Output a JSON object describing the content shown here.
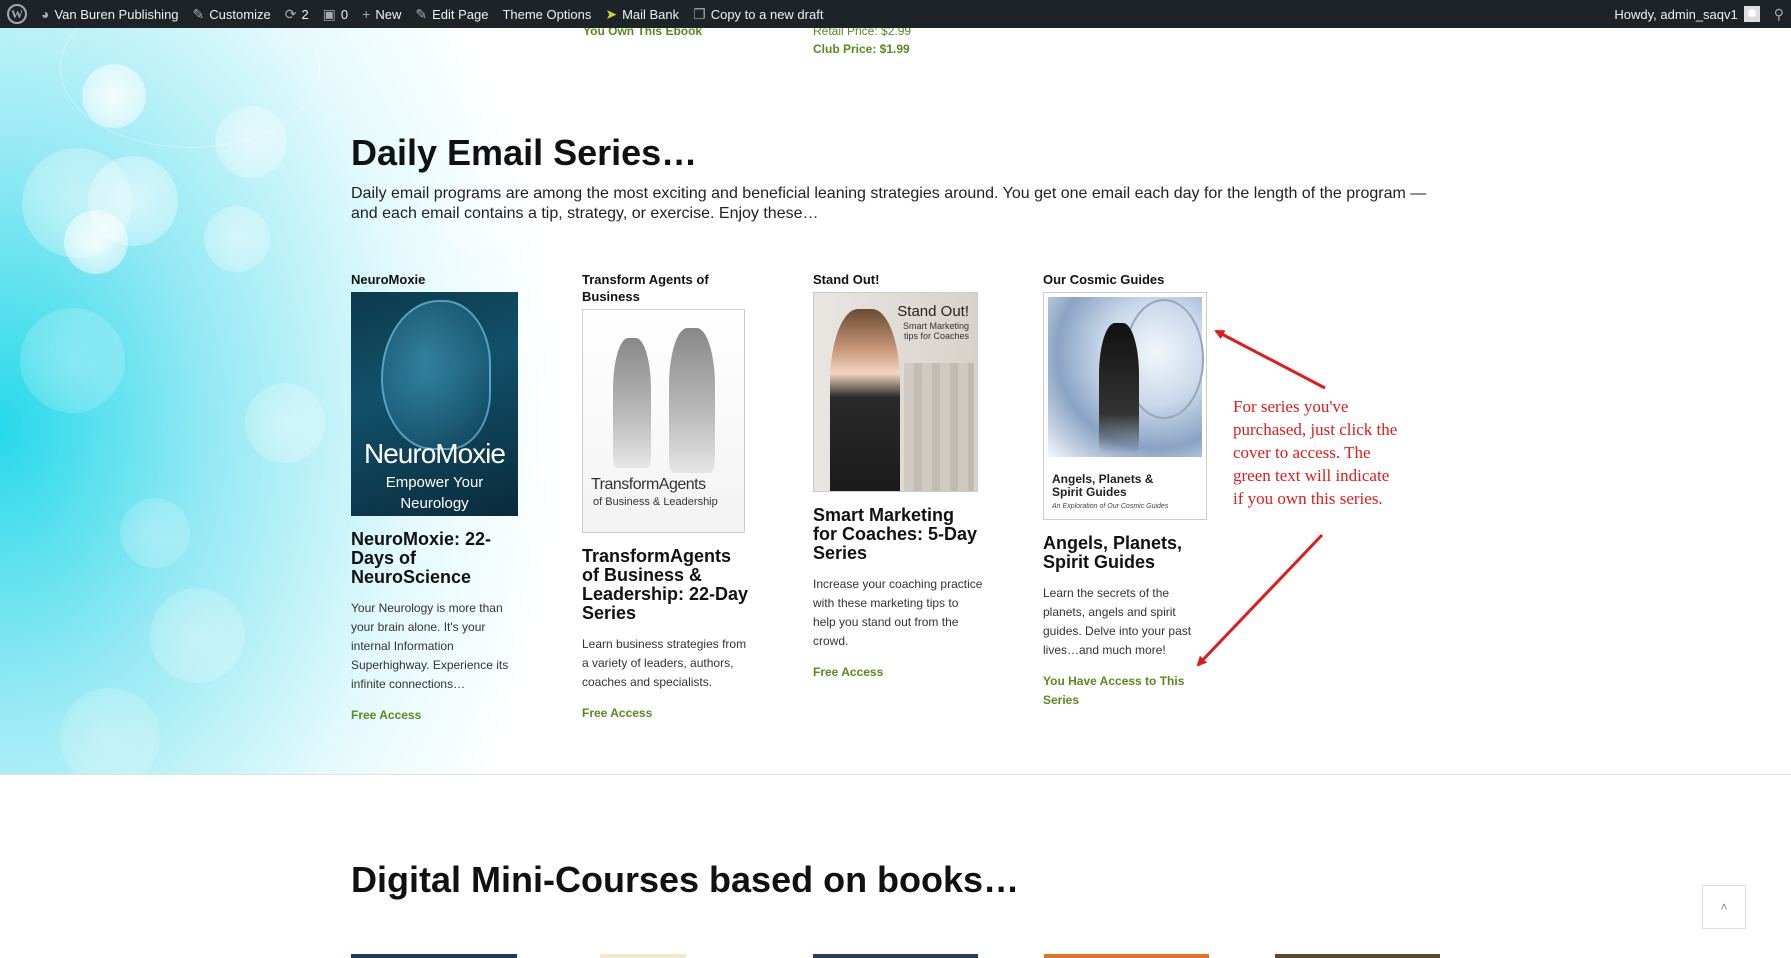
{
  "adminbar": {
    "site_name": "Van Buren Publishing",
    "customize": "Customize",
    "updates_count": "2",
    "comments_count": "0",
    "new": "New",
    "edit_page": "Edit Page",
    "theme_options": "Theme Options",
    "mail_bank": "Mail Bank",
    "copy_draft": "Copy to a new draft",
    "howdy": "Howdy, admin_saqv1"
  },
  "top_residual": {
    "left_text": "You Own This Ebook",
    "retail_price": "Retail Price: $2.99",
    "club_price": "Club Price: $1.99"
  },
  "section": {
    "title": "Daily Email Series…",
    "intro": "Daily email programs are among the most exciting and beneficial leaning strategies around. You get one email each day for the length of the program — and each email contains a tip, strategy, or exercise. Enjoy these…"
  },
  "cards": [
    {
      "label": "NeuroMoxie",
      "cover_title": "NeuroMoxie",
      "cover_subtitle": "Empower Your Neurology",
      "title": "NeuroMoxie: 22-Days of NeuroScience",
      "desc": "Your Neurology is more than your brain alone. It's your internal Information Superhighway. Experience its infinite connections…",
      "link": "Free Access"
    },
    {
      "label": "Transform Agents of Business",
      "cover_title": "TransformAgents",
      "cover_subtitle": "of Business & Leadership",
      "title": "TransformAgents of Business & Leadership: 22-Day Series",
      "desc": "Learn business strategies from a variety of leaders, authors, coaches and specialists.",
      "link": "Free Access"
    },
    {
      "label": "Stand Out!",
      "cover_title": "Stand Out!",
      "cover_subtitle": "Smart Marketing tips for Coaches",
      "title": "Smart Marketing for Coaches: 5-Day Series",
      "desc": "Increase your coaching practice with these marketing tips to help you stand out from the crowd.",
      "link": "Free Access"
    },
    {
      "label": "Our Cosmic Guides",
      "cover_title": "Angels, Planets & Spirit Guides",
      "cover_subtitle": "An Exploration of Our Cosmic Guides",
      "title": "Angels, Planets, Spirit Guides",
      "desc": "Learn the secrets of the planets, angels and spirit guides. Delve into your past lives…and much more!",
      "link": "You Have Access to This Series"
    }
  ],
  "annotation": "For series you've purchased, just click the cover to access. The green text will indicate if you own this series.",
  "section2": {
    "title": "Digital Mini-Courses based on books…"
  },
  "scroll_top": "˄",
  "colors": {
    "admin_bar": "#1d2327",
    "access_green": "#5a8a1d",
    "annotation_red": "#e01b1b"
  }
}
